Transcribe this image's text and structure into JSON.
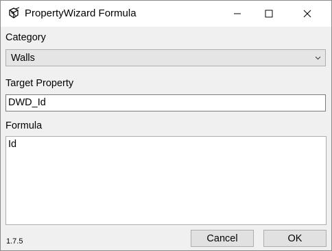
{
  "window": {
    "title": "PropertyWizard Formula",
    "icons": {
      "app": "app-cube-icon",
      "minimize": "minimize-icon",
      "maximize": "maximize-icon",
      "close": "close-icon"
    }
  },
  "form": {
    "category_label": "Category",
    "category_value": "Walls",
    "target_label": "Target Property",
    "target_value": "DWD_Id",
    "formula_label": "Formula",
    "formula_value": "Id"
  },
  "footer": {
    "version": "1.7.5",
    "cancel_label": "Cancel",
    "ok_label": "OK"
  },
  "colors": {
    "titlebar_bg": "#ffffff",
    "window_bg": "#f0f0f0",
    "button_bg": "#e1e1e1",
    "border": "#adadad"
  }
}
